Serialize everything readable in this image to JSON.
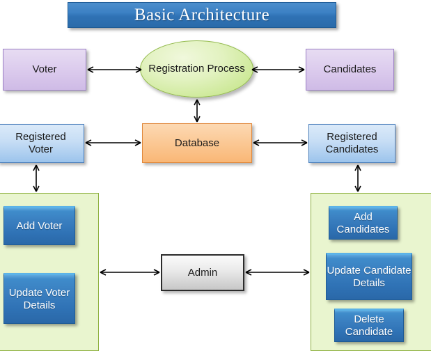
{
  "diagram": {
    "title": "Basic Architecture",
    "nodes": {
      "voter": "Voter",
      "registration_process": "Registration\nProcess",
      "registration_process_line1": "Registration",
      "registration_process_line2": "Process",
      "candidates": "Candidates",
      "registered_voter_line1": "Registered",
      "registered_voter_line2": "Voter",
      "database": "Database",
      "registered_candidates_line1": "Registered",
      "registered_candidates_line2": "Candidates",
      "admin": "Admin",
      "add_voter": "Add Voter",
      "update_voter_details_line1": "Update",
      "update_voter_details_line2": "Voter",
      "update_voter_details_line3": "Details",
      "add_candidates_line1": "Add",
      "add_candidates_line2": "Candidates",
      "update_candidate_details_line1": "Update",
      "update_candidate_details_line2": "Candidate",
      "update_candidate_details_line3": "Details",
      "delete_candidate_line1": "Delete",
      "delete_candidate_line2": "Candidate"
    },
    "colors": {
      "title_banner": "#2f72b5",
      "actor_box": "#d5c4ea",
      "registered_box": "#bcd8f3",
      "process_ellipse": "#d3ec9f",
      "database_box": "#fbc894",
      "admin_box": "#e0e0e0",
      "group_container": "#e9f5cf",
      "group_border": "#8db03e",
      "action_button": "#2f72b5",
      "connector": "#000000"
    },
    "connectors": [
      {
        "name": "voter-to-registration",
        "from": "voter",
        "to": "registration_process",
        "arrows": "both",
        "orientation": "horizontal"
      },
      {
        "name": "candidates-to-registration",
        "from": "candidates",
        "to": "registration_process",
        "arrows": "both",
        "orientation": "horizontal"
      },
      {
        "name": "registration-to-database",
        "from": "registration_process",
        "to": "database",
        "arrows": "both",
        "orientation": "vertical"
      },
      {
        "name": "registered-voter-to-database",
        "from": "registered_voter",
        "to": "database",
        "arrows": "both",
        "orientation": "horizontal"
      },
      {
        "name": "database-to-registered-candidates",
        "from": "database",
        "to": "registered_candidates",
        "arrows": "both",
        "orientation": "horizontal"
      },
      {
        "name": "registered-voter-to-voter-group",
        "from": "registered_voter",
        "to": "voter_group",
        "arrows": "both",
        "orientation": "vertical"
      },
      {
        "name": "registered-candidates-to-candidate-group",
        "from": "registered_candidates",
        "to": "candidate_group",
        "arrows": "both",
        "orientation": "vertical"
      },
      {
        "name": "voter-group-to-admin",
        "from": "voter_group",
        "to": "admin",
        "arrows": "both",
        "orientation": "horizontal"
      },
      {
        "name": "admin-to-candidate-group",
        "from": "admin",
        "to": "candidate_group",
        "arrows": "both",
        "orientation": "horizontal"
      }
    ]
  }
}
